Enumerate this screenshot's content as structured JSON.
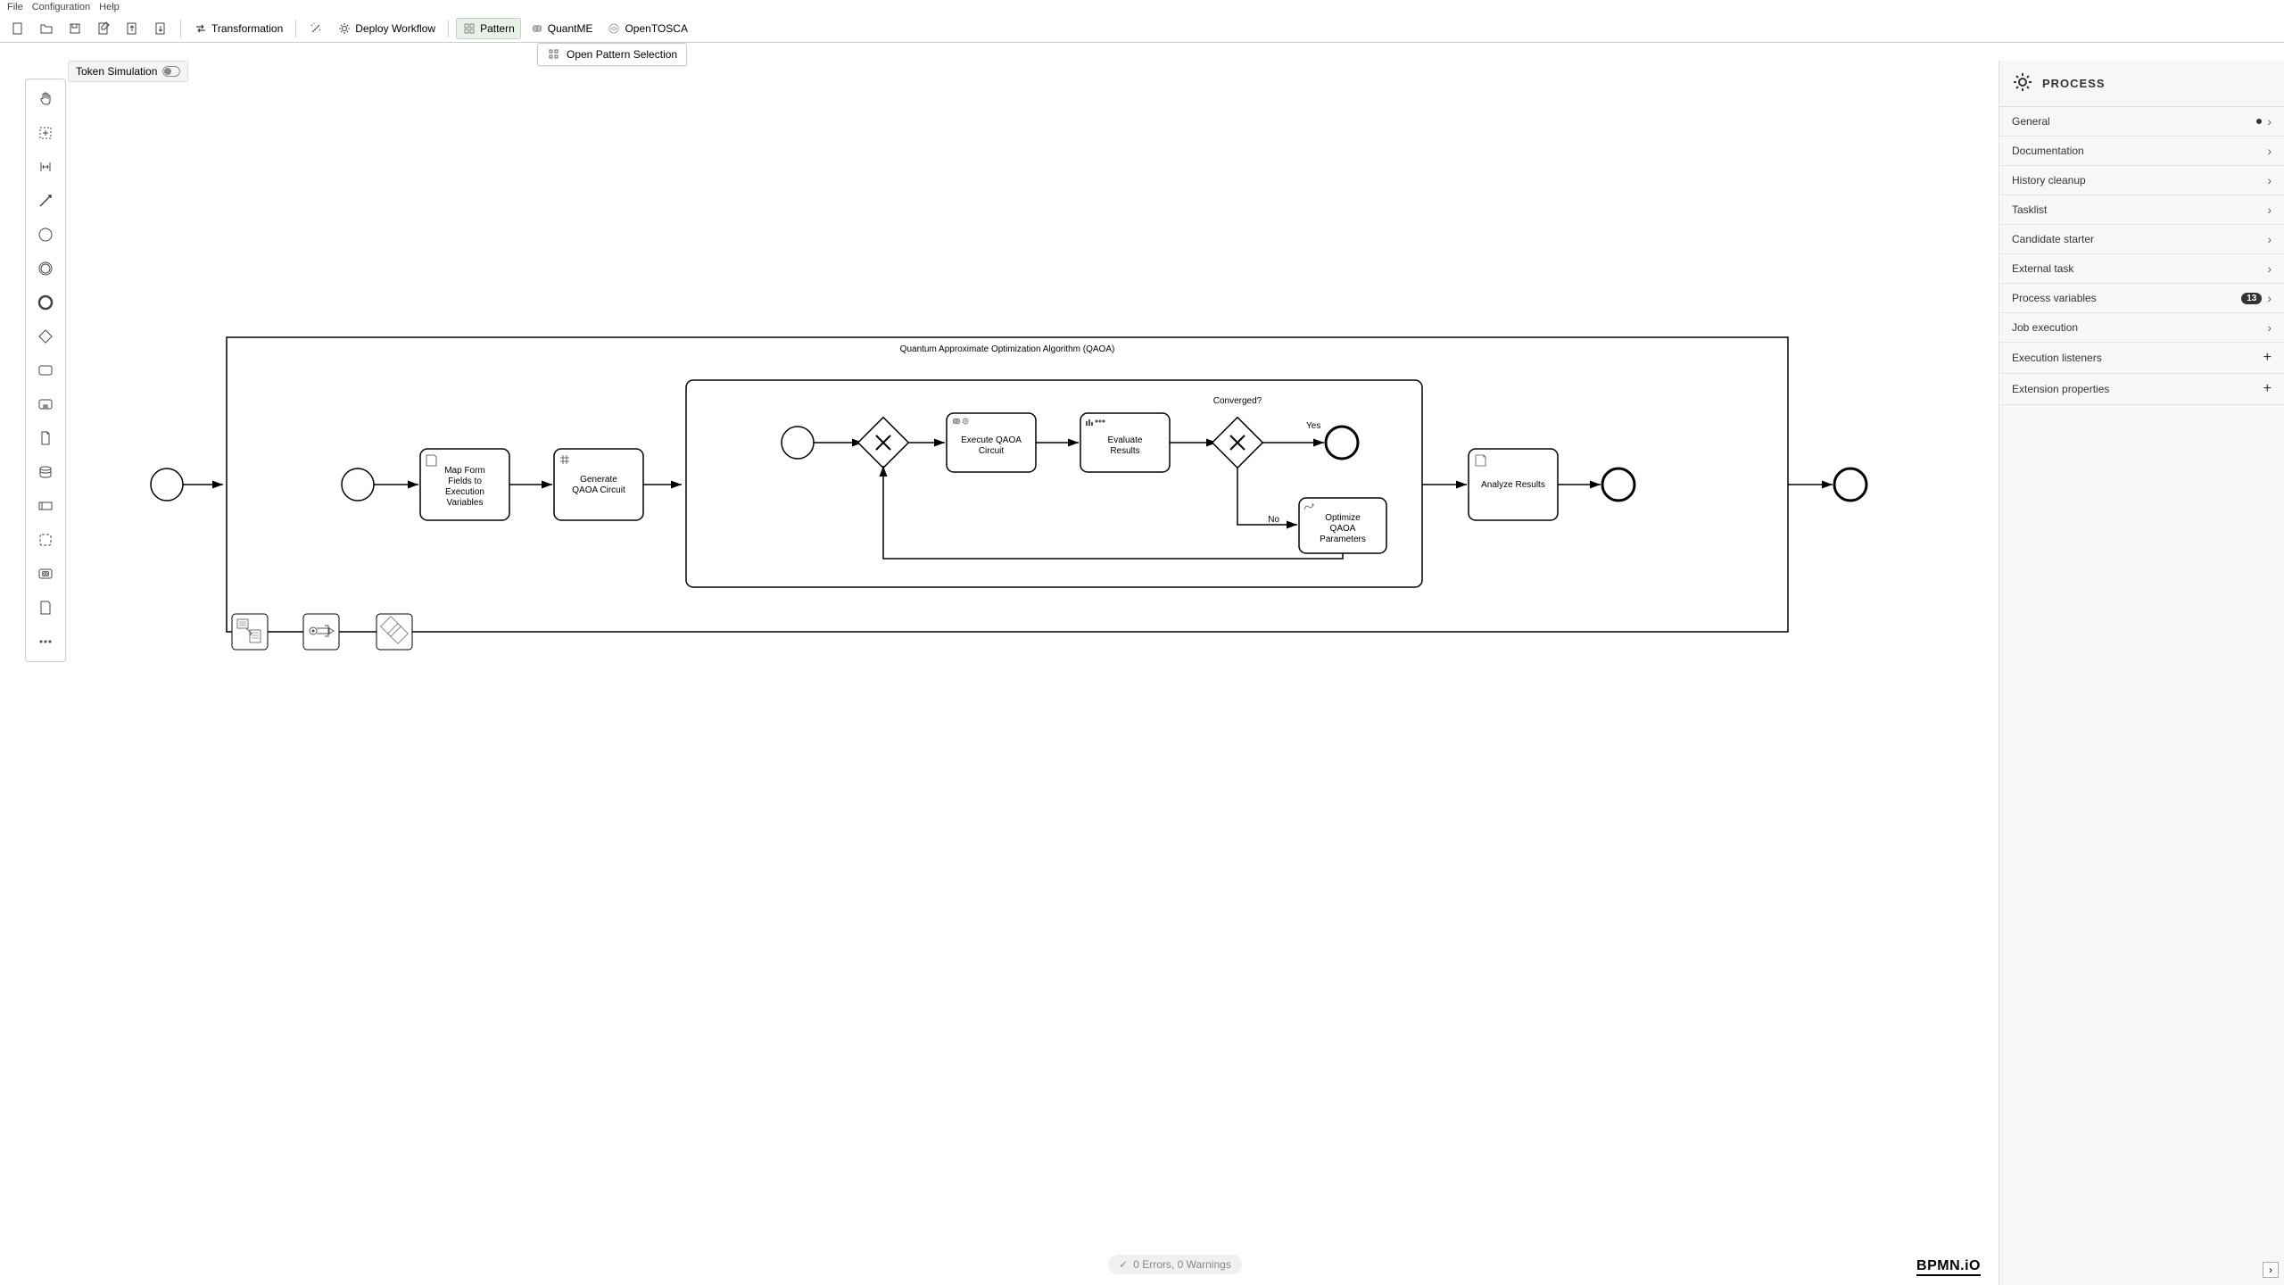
{
  "menu": {
    "file": "File",
    "config": "Configuration",
    "help": "Help"
  },
  "toolbar": {
    "transformation": "Transformation",
    "deploy": "Deploy Workflow",
    "pattern": "Pattern",
    "quantme": "QuantME",
    "opentosca": "OpenTOSCA",
    "open_pattern_selection": "Open Pattern Selection"
  },
  "token_sim": "Token Simulation",
  "properties": {
    "title": "PROCESS",
    "sections": {
      "general": "General",
      "documentation": "Documentation",
      "history_cleanup": "History cleanup",
      "tasklist": "Tasklist",
      "candidate_starter": "Candidate starter",
      "external_task": "External task",
      "process_variables": "Process variables",
      "process_variables_count": "13",
      "job_execution": "Job execution",
      "execution_listeners": "Execution listeners",
      "extension_properties": "Extension properties"
    }
  },
  "diagram": {
    "pool_title": "Quantum Approximate Optimization Algorithm (QAOA)",
    "tasks": {
      "map_form": [
        "Map Form",
        "Fields to",
        "Execution",
        "Variables"
      ],
      "gen_circuit": [
        "Generate",
        "QAOA Circuit"
      ],
      "exec_circuit": [
        "Execute QAOA",
        "Circuit"
      ],
      "eval_results": [
        "Evaluate",
        "Results"
      ],
      "optimize": [
        "Optimize",
        "QAOA",
        "Parameters"
      ],
      "analyze": "Analyze Results"
    },
    "gateway_label": "Converged?",
    "edge_yes": "Yes",
    "edge_no": "No"
  },
  "lint": "0 Errors, 0 Warnings",
  "bpmn_logo": "BPMN.iO"
}
